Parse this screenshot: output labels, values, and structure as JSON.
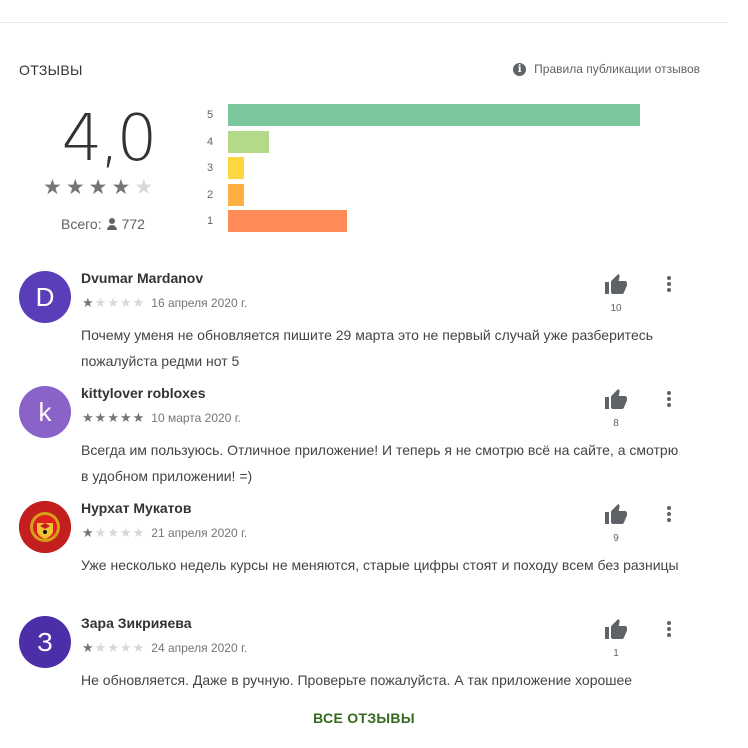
{
  "section_title": "ОТЗЫВЫ",
  "policy_link": "Правила публикации отзывов",
  "rating": {
    "value": "4,0",
    "stars_filled": 4,
    "stars_total": 5,
    "total_label": "Всего:",
    "total_count": "772"
  },
  "histogram": [
    {
      "label": "5",
      "fraction": 1.0,
      "color": "#7ac79e"
    },
    {
      "label": "4",
      "fraction": 0.1,
      "color": "#b4d98b"
    },
    {
      "label": "3",
      "fraction": 0.04,
      "color": "#ffd741"
    },
    {
      "label": "2",
      "fraction": 0.04,
      "color": "#fcb043"
    },
    {
      "label": "1",
      "fraction": 0.29,
      "color": "#fe8c5a"
    }
  ],
  "reviews": [
    {
      "author": "Dvumar Mardanov",
      "avatar_letter": "D",
      "avatar_color": "#5a3db8",
      "stars": 1,
      "date": "16 апреля 2020 г.",
      "text": "Почему уменя не обновляется пишите 29 марта это не первый случай уже разберитесь пожалуйста редми нот 5",
      "likes": "10"
    },
    {
      "author": "kittylover robloxes",
      "avatar_letter": "k",
      "avatar_color": "#8a63c9",
      "stars": 5,
      "date": "10 марта 2020 г.",
      "text": "Всегда им пользуюсь. Отличное приложение! И теперь я не смотрю всё на сайте, а смотрю в удобном приложении! =)",
      "likes": "8"
    },
    {
      "author": "Нурхат Мукатов",
      "avatar_letter": "",
      "avatar_color": "#c41f1f",
      "stars": 1,
      "date": "21 апреля 2020 г.",
      "text": "Уже несколько недель курсы не меняются, старые цифры стоят и походу всем без разницы",
      "likes": "9"
    },
    {
      "author": "Зара Зикрияева",
      "avatar_letter": "З",
      "avatar_color": "#4b2ea8",
      "stars": 1,
      "date": "24 апреля 2020 г.",
      "text": "Не обновляется. Даже в ручную. Проверьте пожалуйста. А так приложение хорошее",
      "likes": "1"
    }
  ],
  "all_reviews_button": "ВСЕ ОТЗЫВЫ"
}
